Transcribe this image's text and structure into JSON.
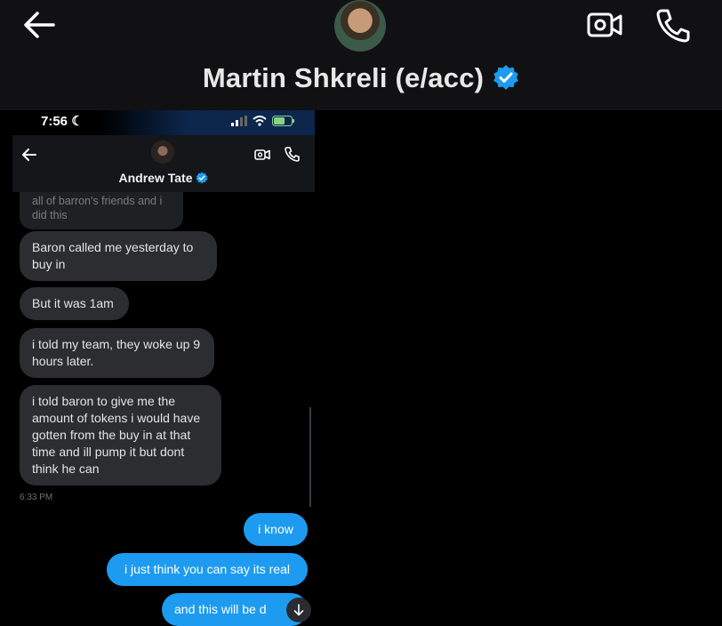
{
  "outer": {
    "title": "Martin Shkreli (e/acc)",
    "icons": [
      "back-arrow-icon",
      "video-call-icon",
      "phone-call-icon",
      "verified-badge-icon"
    ],
    "accent_color": "#1d9bf0"
  },
  "inner": {
    "status": {
      "time": "7:56"
    },
    "contact_name": "Andrew Tate",
    "messages": [
      {
        "dir": "in",
        "text": "all of barron's friends and i did this"
      },
      {
        "dir": "in",
        "text": "Baron called me yesterday to buy in"
      },
      {
        "dir": "in",
        "text": "But it was 1am"
      },
      {
        "dir": "in",
        "text": "i told my team, they woke up 9 hours later."
      },
      {
        "dir": "in",
        "text": "i told baron to give me the amount of tokens i would have gotten from the buy in at that time and ill pump it but dont think he can"
      },
      {
        "dir": "out",
        "text": "i know"
      },
      {
        "dir": "out",
        "text": "i just think you can say its real"
      },
      {
        "dir": "out",
        "text": "and this will be d"
      }
    ],
    "timestamp": "6:33 PM"
  }
}
